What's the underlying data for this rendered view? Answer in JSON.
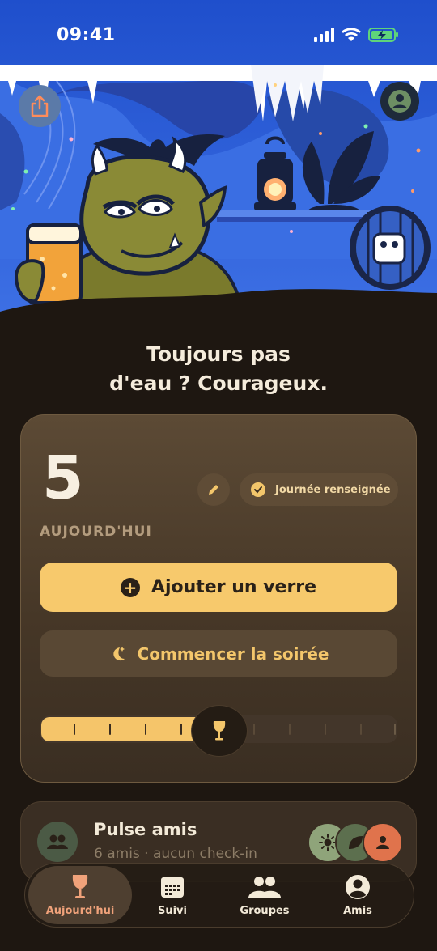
{
  "status_bar": {
    "time": "09:41"
  },
  "headline": {
    "line1": "Toujours pas",
    "line2": "d'eau ? Courageux."
  },
  "today_card": {
    "count": "5",
    "count_label": "AUJOURD'HUI",
    "status_pill": "Journée renseignée",
    "add_button": "Ajouter un verre",
    "night_button": "Commencer la soirée",
    "slider_fill": 0.5
  },
  "friends_pulse": {
    "title": "Pulse amis",
    "subtitle": "6 amis · aucun check-in"
  },
  "tab_bar": {
    "tabs": [
      {
        "label": "Aujourd'hui",
        "icon": "wine-glass-icon",
        "active": true
      },
      {
        "label": "Suivi",
        "icon": "calendar-icon",
        "active": false
      },
      {
        "label": "Groupes",
        "icon": "people-icon",
        "active": false
      },
      {
        "label": "Amis",
        "icon": "person-icon",
        "active": false
      }
    ]
  },
  "colors": {
    "background": "#1e1711",
    "accent": "#f7c96c",
    "active_tab": "#f0a27a",
    "hero_blue": "#2f5fd6"
  }
}
